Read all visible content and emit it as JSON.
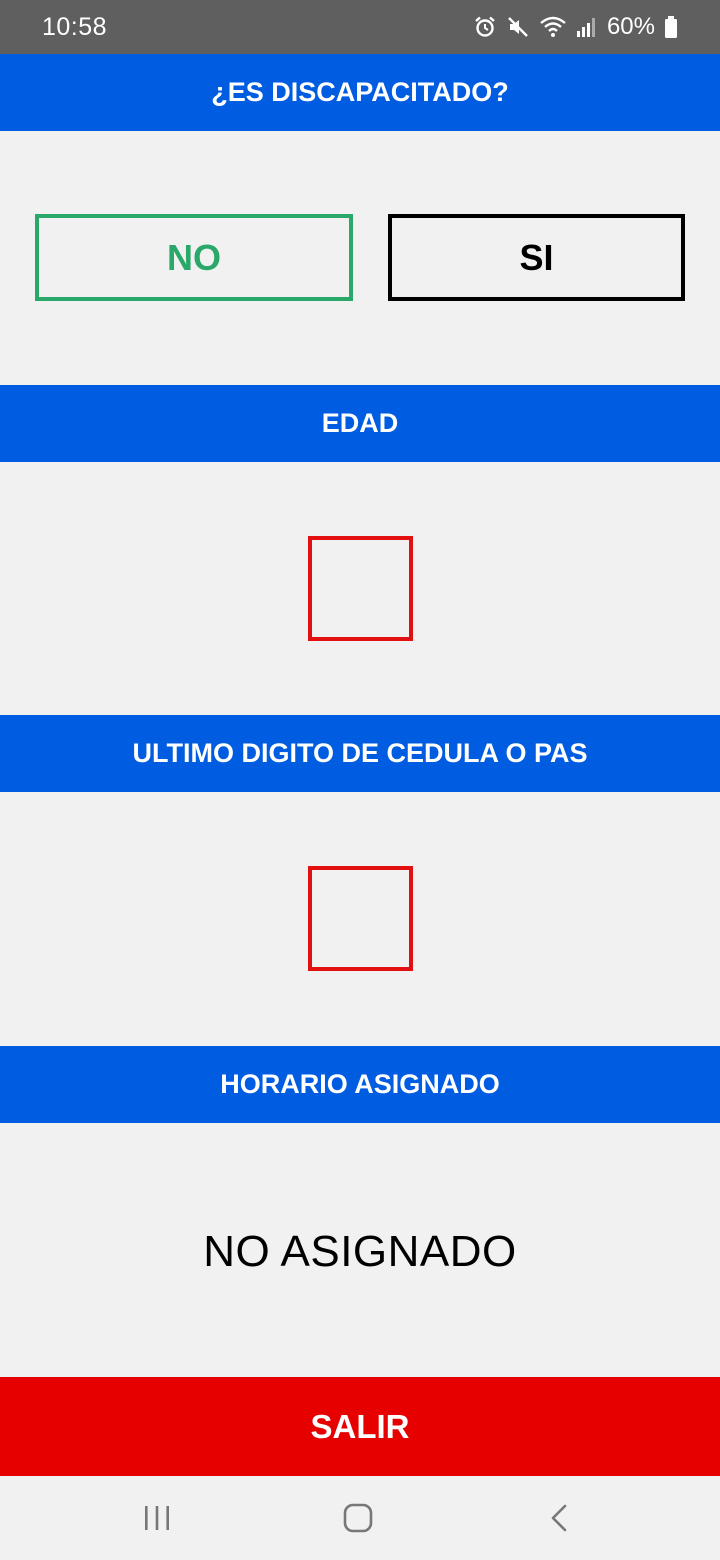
{
  "status_bar": {
    "time": "10:58",
    "battery_percent": "60%",
    "icons": [
      "alarm-icon",
      "mute-icon",
      "wifi-icon",
      "signal-icon",
      "battery-icon"
    ]
  },
  "sections": {
    "disability_header": "¿ES DISCAPACITADO?",
    "age_header": "EDAD",
    "digit_header": "ULTIMO DIGITO DE CEDULA O PAS",
    "schedule_header": "HORARIO ASIGNADO"
  },
  "disability_options": {
    "no_label": "NO",
    "si_label": "SI",
    "selected": "NO"
  },
  "inputs": {
    "age_value": "",
    "digit_value": ""
  },
  "schedule": {
    "value": "NO ASIGNADO"
  },
  "actions": {
    "exit_label": "SALIR"
  },
  "colors": {
    "header_blue": "#005ce1",
    "selected_green": "#2aa86a",
    "input_red": "#e21010",
    "exit_red": "#e60000",
    "background": "#f1f1f1"
  },
  "nav_bar": {
    "icons": [
      "recent-apps-icon",
      "home-icon",
      "back-icon"
    ]
  }
}
